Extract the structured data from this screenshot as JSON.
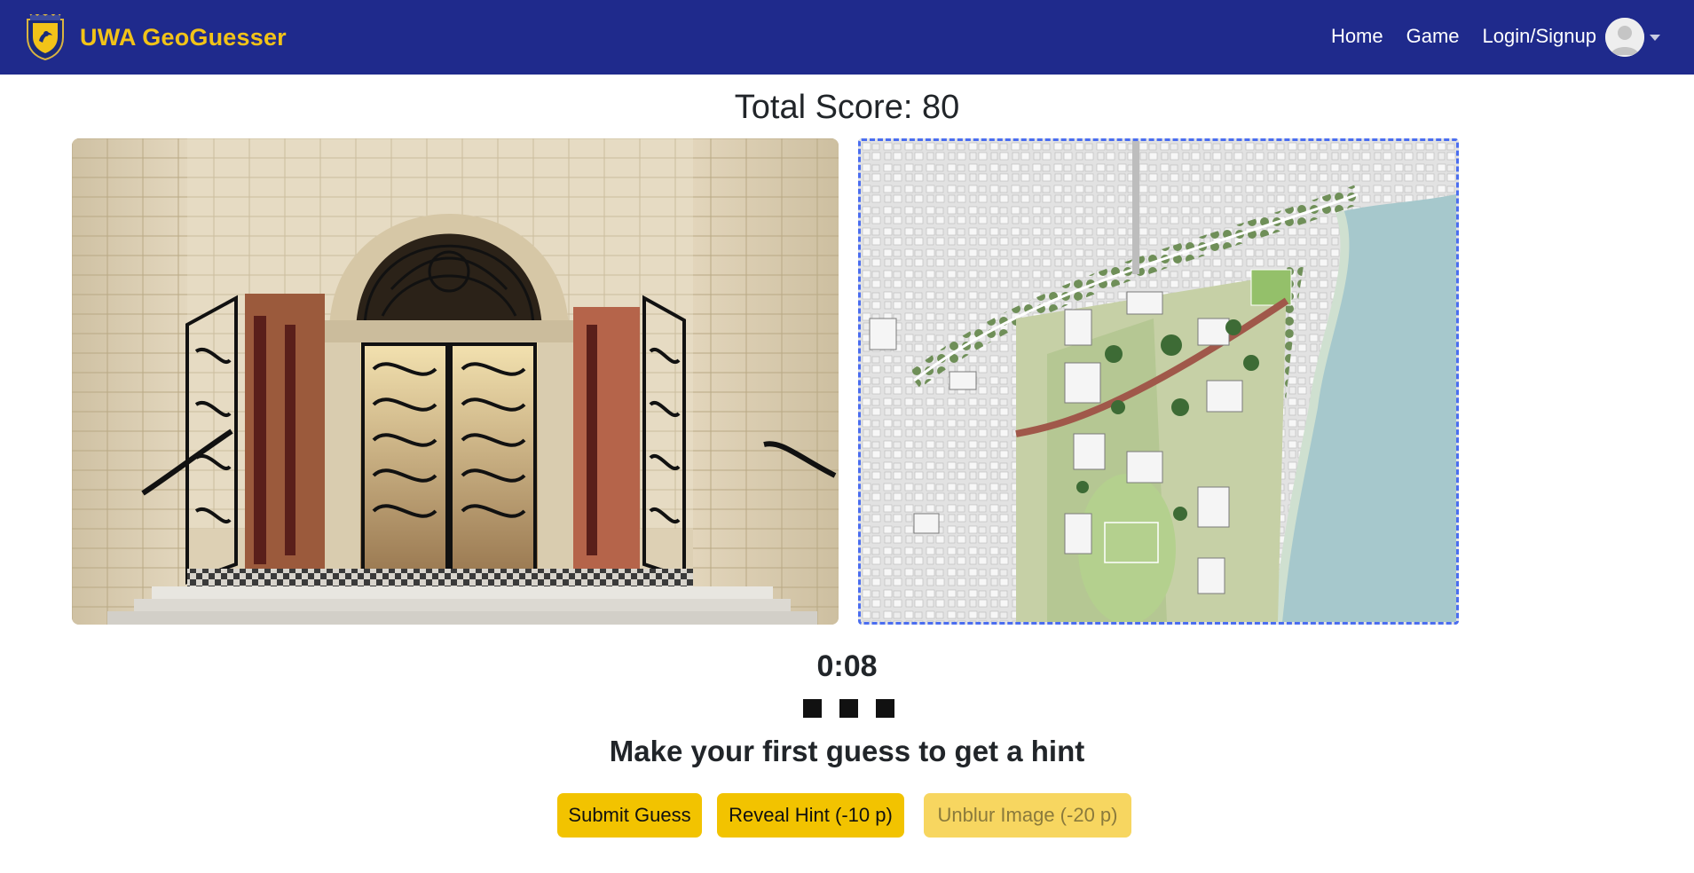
{
  "navbar": {
    "brand": "UWA GeoGuesser",
    "links": [
      "Home",
      "Game",
      "Login/Signup"
    ],
    "colors": {
      "background": "#1f2a8c",
      "brand_text": "#f2c318"
    }
  },
  "game": {
    "total_score_text": "Total Score: 80",
    "timer": "0:08",
    "hints_remaining": 3,
    "hint_message": "Make your first guess to get a hint",
    "buttons": {
      "submit": "Submit Guess",
      "reveal": "Reveal Hint (-10 p)",
      "unblur": "Unblur Image (-20 p)"
    }
  },
  "icons": {
    "crest": "uwa-crest-icon",
    "avatar": "user-avatar-icon",
    "caret": "chevron-down-icon"
  }
}
